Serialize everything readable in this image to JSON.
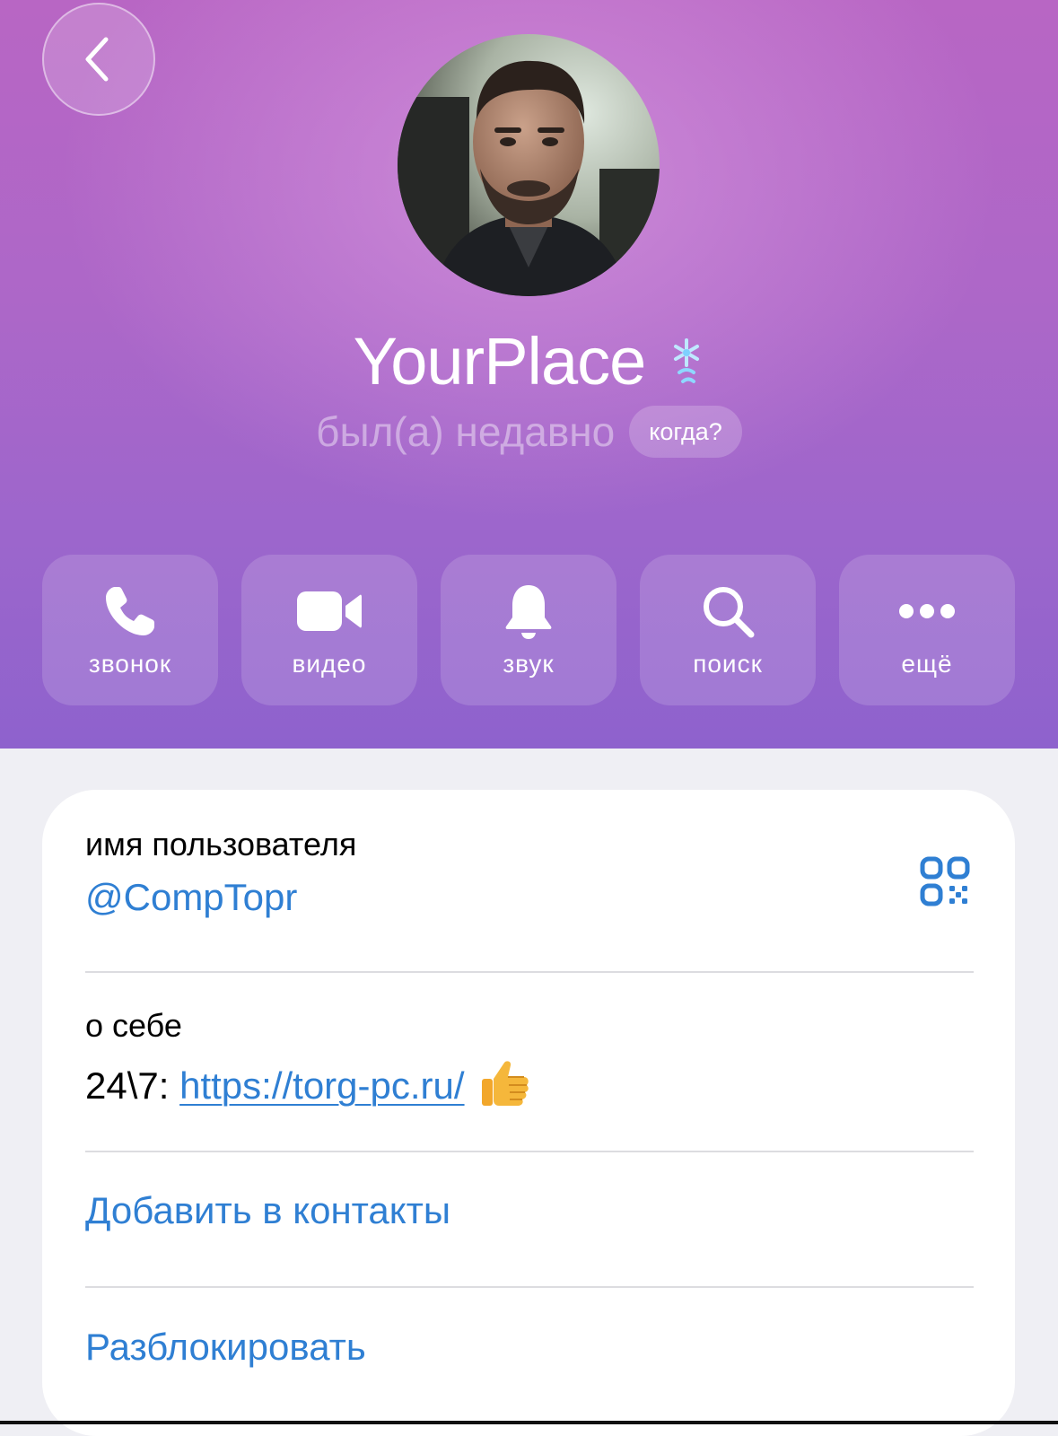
{
  "profile": {
    "name": "YourPlace",
    "status": "был(а) недавно",
    "when_label": "когда?"
  },
  "actions": [
    {
      "label": "звонок",
      "icon": "phone-icon"
    },
    {
      "label": "видео",
      "icon": "video-camera-icon"
    },
    {
      "label": "звук",
      "icon": "bell-icon"
    },
    {
      "label": "поиск",
      "icon": "search-icon"
    },
    {
      "label": "ещё",
      "icon": "more-dots-icon"
    }
  ],
  "info": {
    "username_label": "имя пользователя",
    "username_value": "@CompTopr",
    "about_label": "о себе",
    "about_prefix": "24\\7: ",
    "about_link": "https://torg-pc.ru/",
    "add_contact": "Добавить в контакты",
    "unblock": "Разблокировать"
  },
  "colors": {
    "accent": "#2f7fd3",
    "header_top": "#b866c4",
    "header_bottom": "#8e62cd"
  }
}
